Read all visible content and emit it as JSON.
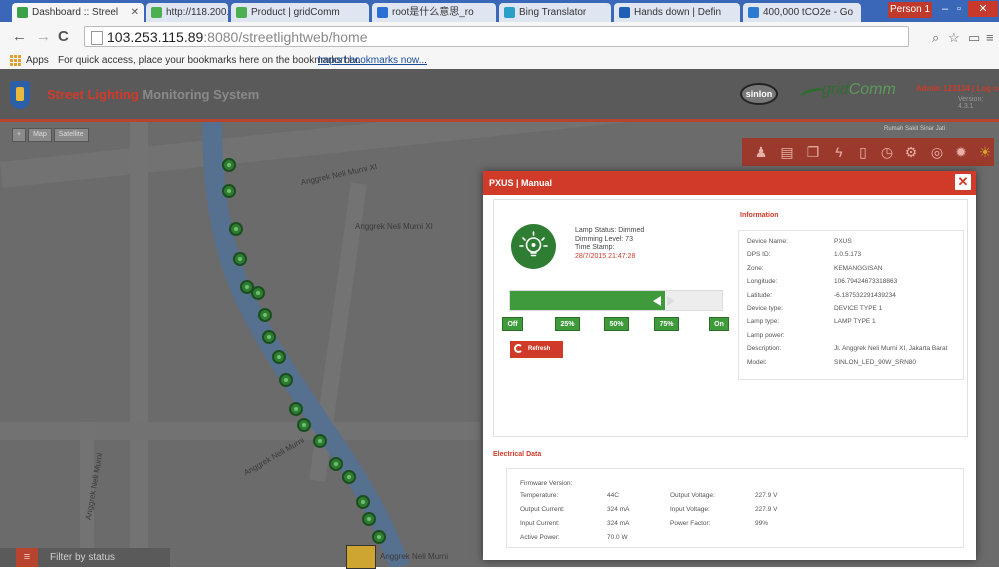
{
  "browser": {
    "tabs": [
      {
        "label": "Dashboard :: Streel",
        "active": true,
        "color": "#3aa04a"
      },
      {
        "label": "http://118.200.71.1",
        "active": false,
        "color": "#4caf50"
      },
      {
        "label": "Product | gridComm",
        "active": false,
        "color": "#4caf50"
      },
      {
        "label": "root是什么意思_ro",
        "active": false,
        "color": "#2a6fd1"
      },
      {
        "label": "Bing Translator",
        "active": false,
        "color": "#2c9fc8"
      },
      {
        "label": "Hands down | Defin",
        "active": false,
        "color": "#1f5fb4"
      },
      {
        "label": "400,000 tCO2e - Go",
        "active": false,
        "color": "#2a7ad1"
      }
    ],
    "profile": "Person 1",
    "url_host": "103.253.115.89",
    "url_path": ":8080/streetlightweb/home",
    "bookmarks": {
      "apps": "Apps",
      "hint": "For quick access, place your bookmarks here on the bookmarks bar.",
      "import_link": "Import bookmarks now..."
    }
  },
  "app": {
    "title_red": "Street Lighting",
    "title_grey": "Monitoring System",
    "logo_sinlon": "sinlon",
    "logo_gridcomm_a": "grid",
    "logo_gridcomm_b": "Comm",
    "user_links": "Admin 123134 | Log out",
    "version": "Version: 4.3.1"
  },
  "map": {
    "controls": [
      "+",
      "Map",
      "Satellite"
    ],
    "streets": [
      "Anggrek Neli Murni XI",
      "Anggrek Neli Murni XI",
      "Anggrek Neli Murni",
      "Anggrek Neli Murni",
      "Anggrek Neli Murni"
    ],
    "toolbar_label": "Rumah Sakit Sinar Jati",
    "filter_label": "Filter by status"
  },
  "modal": {
    "title": "PXUS | Manual",
    "lamp": {
      "status_label": "Lamp Status: Dimmed",
      "dimming_label": "Dimming Level: 73",
      "timestamp_label": "Time Stamp:",
      "timestamp": "28/7/2015 21:47:28",
      "level": 73
    },
    "dim_buttons": [
      "Off",
      "25%",
      "50%",
      "75%",
      "On"
    ],
    "refresh_label": "Refresh",
    "information": {
      "heading": "Information",
      "rows": [
        {
          "k": "Device Name:",
          "v": "PXUS"
        },
        {
          "k": "DPS ID:",
          "v": "1.0.5.173"
        },
        {
          "k": "Zone:",
          "v": "KEMANGGISAN"
        },
        {
          "k": "Longitude:",
          "v": "106.79424673318863"
        },
        {
          "k": "Latitude:",
          "v": "-6.187532291439234"
        },
        {
          "k": "Device type:",
          "v": "DEVICE TYPE 1"
        },
        {
          "k": "Lamp type:",
          "v": "LAMP TYPE 1"
        },
        {
          "k": "Lamp power:",
          "v": ""
        },
        {
          "k": "Description:",
          "v": "Jl. Anggrek Neli Murni XI, Jakarta Barat"
        },
        {
          "k": "Model:",
          "v": "SINLON_LED_90W_SRN80"
        }
      ]
    },
    "electrical": {
      "heading": "Electrical Data",
      "firmware": "Firmware Version:",
      "left": [
        {
          "k": "Temperature:",
          "v": "44C"
        },
        {
          "k": "Output Current:",
          "v": "324 mA"
        },
        {
          "k": "Input Current:",
          "v": "324 mA"
        },
        {
          "k": "Active Power:",
          "v": "70.0 W"
        }
      ],
      "right": [
        {
          "k": "Output Voltage:",
          "v": "227.9 V"
        },
        {
          "k": "Input Voltage:",
          "v": "227.9 V"
        },
        {
          "k": "Power Factor:",
          "v": "99%"
        }
      ]
    }
  }
}
